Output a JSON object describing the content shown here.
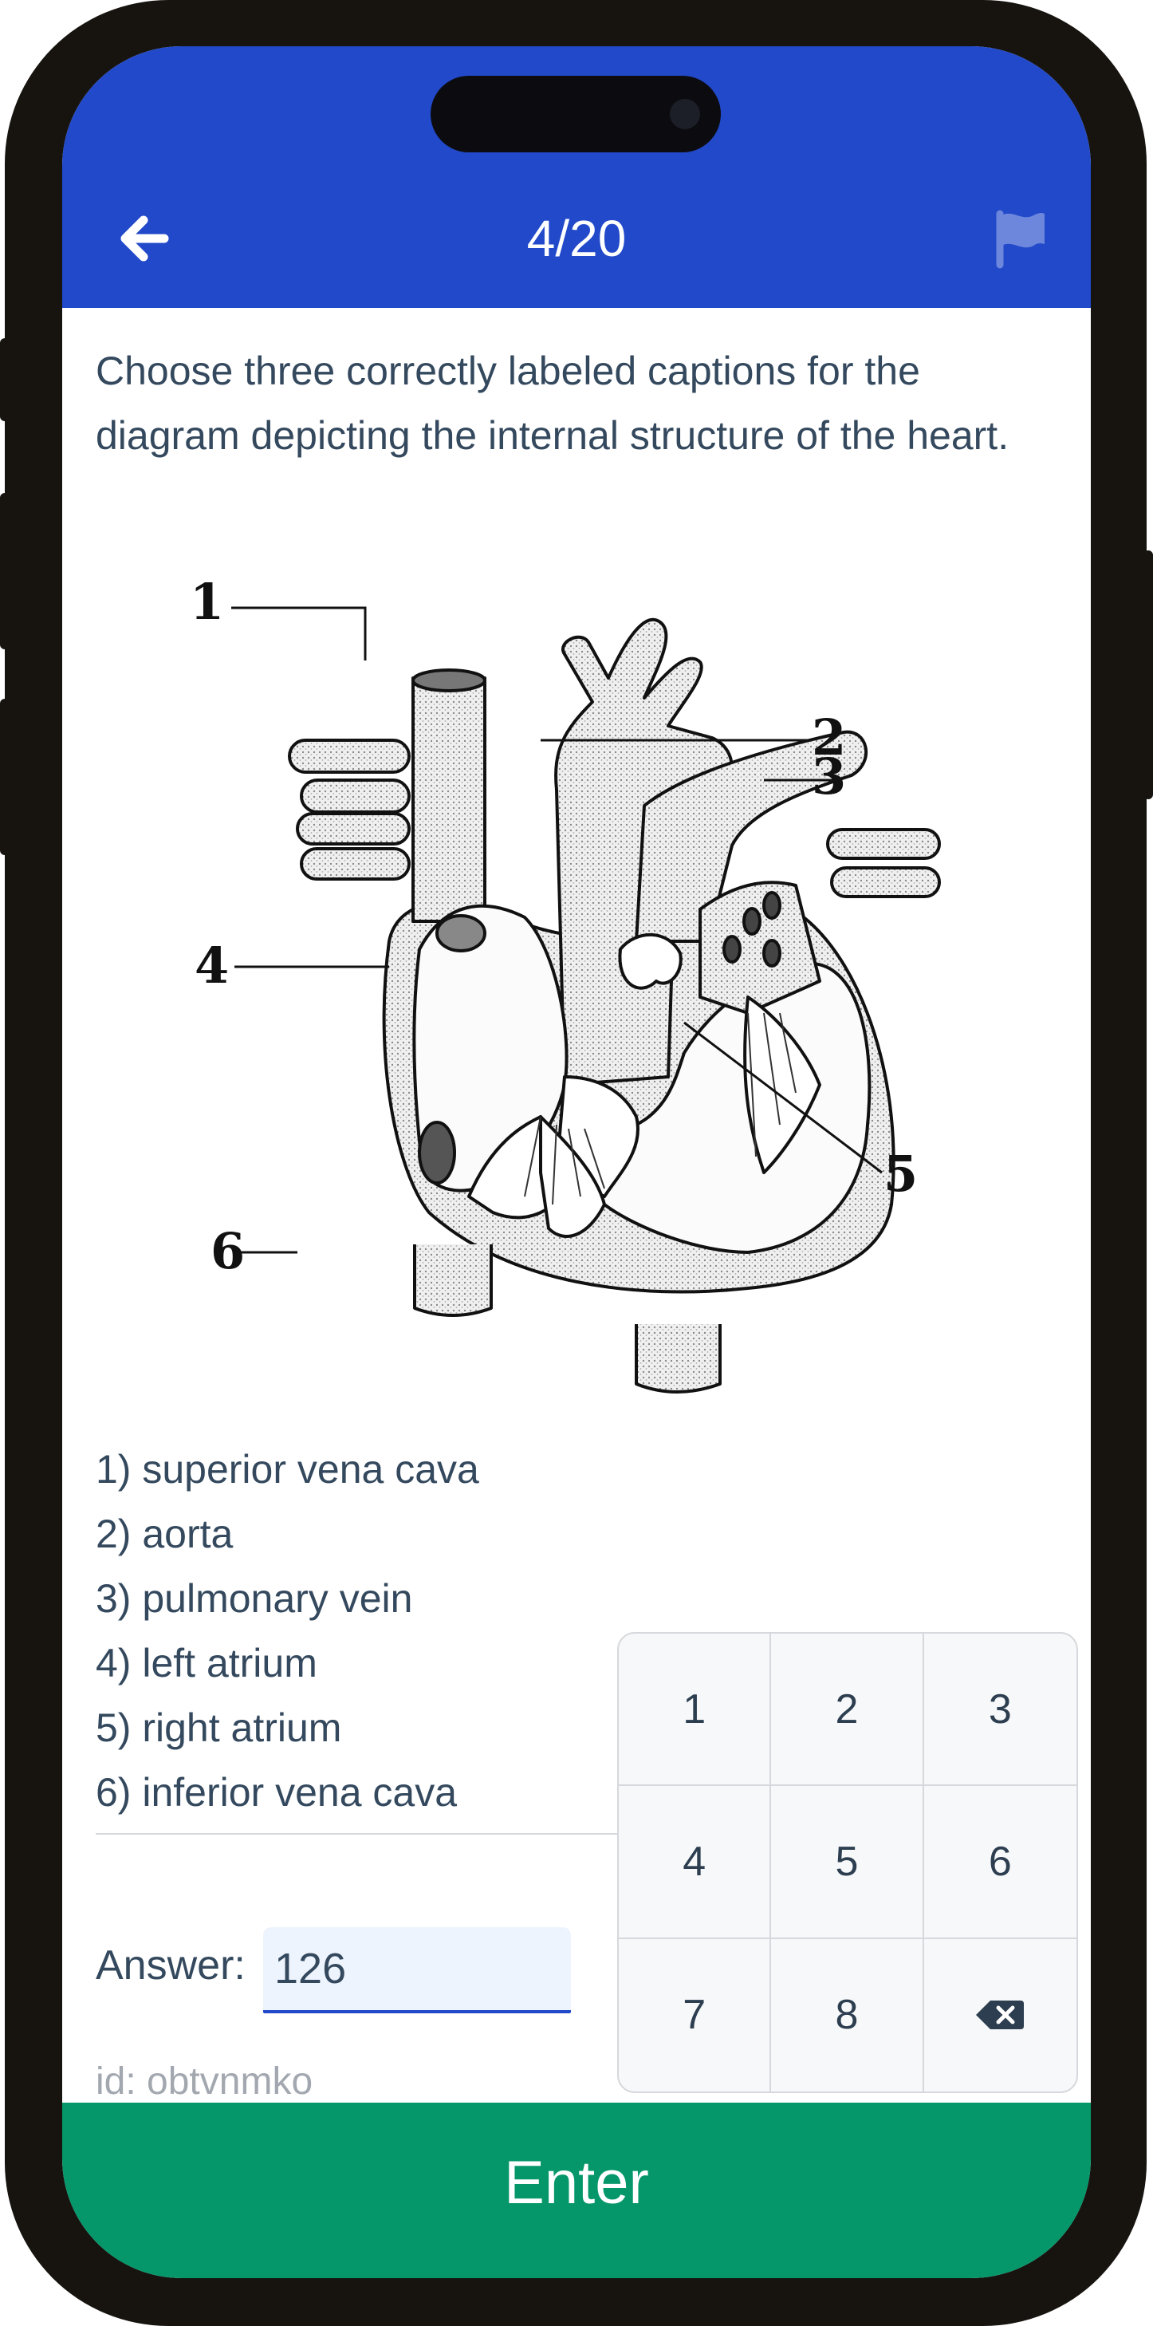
{
  "header": {
    "progress": "4/20",
    "icons": {
      "back": "arrow-left-icon",
      "flag": "flag-icon"
    },
    "colors": {
      "background": "#2149c9",
      "text": "#ffffff",
      "flag": "#6d87dc"
    }
  },
  "question": {
    "text": "Choose three correctly labeled captions for the diagram depicting the internal structure of the heart."
  },
  "diagram": {
    "description_icon": "heart-diagram",
    "labels": [
      "1",
      "2",
      "3",
      "4",
      "5",
      "6"
    ]
  },
  "options": [
    "1) superior vena cava",
    "2) aorta",
    "3) pulmonary vein",
    "4) left atrium",
    "5) right atrium",
    "6) inferior vena cava"
  ],
  "answer": {
    "label": "Answer:",
    "value": "126"
  },
  "item_id": "id: obtvnmko",
  "keypad": {
    "keys": [
      "1",
      "2",
      "3",
      "4",
      "5",
      "6",
      "7",
      "8"
    ],
    "backspace_icon": "backspace-icon"
  },
  "footer": {
    "enter_label": "Enter",
    "color": "#05976a"
  }
}
